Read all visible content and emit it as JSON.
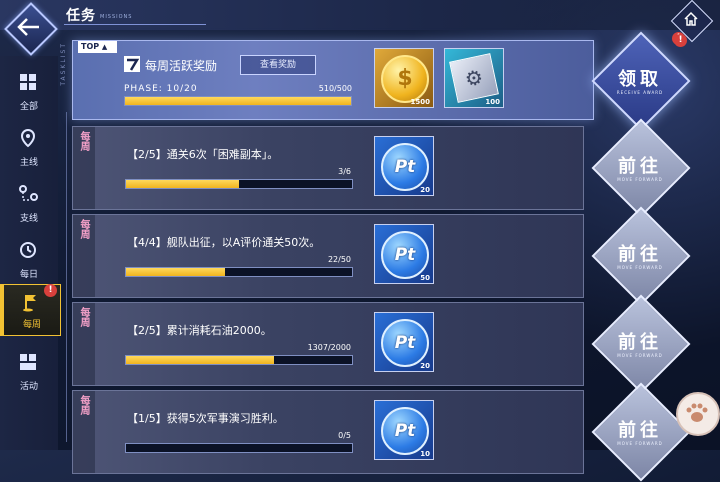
{
  "header": {
    "title": "任务",
    "subtitle": "MISSIONS"
  },
  "sidebar": {
    "tasklist_label": "TASKLIST",
    "items": [
      {
        "label": "全部",
        "icon": "grid-icon"
      },
      {
        "label": "主线",
        "icon": "map-pin-icon"
      },
      {
        "label": "支线",
        "icon": "branch-pins-icon"
      },
      {
        "label": "每日",
        "icon": "clock-icon"
      },
      {
        "label": "每周",
        "icon": "flag-icon",
        "active": true,
        "alert": "!"
      },
      {
        "label": "活动",
        "icon": "blocks-icon"
      }
    ]
  },
  "top_card": {
    "tag": "TOP",
    "title": "每周活跃奖励",
    "view_button": "查看奖励",
    "phase_label": "PHASE: 10/20",
    "progress_text": "510/500",
    "progress_fraction": 1.0,
    "rewards": [
      {
        "icon": "gold-coin-icon",
        "amount": "1500"
      },
      {
        "icon": "equipment-box-icon",
        "amount": "100"
      }
    ],
    "claim_button": {
      "label": "领取",
      "sub": "RECEIVE AWARD",
      "alert": "!"
    }
  },
  "tasks": [
    {
      "kind": "每周",
      "desc": "【2/5】通关6次「困难副本」。",
      "progress": "3/6",
      "fraction": 0.5,
      "reward_amount": "20",
      "button": "前往",
      "button_sub": "MOVE FORWARD"
    },
    {
      "kind": "每周",
      "desc": "【4/4】舰队出征，以A评价通关50次。",
      "progress": "22/50",
      "fraction": 0.44,
      "reward_amount": "50",
      "button": "前往",
      "button_sub": "MOVE FORWARD"
    },
    {
      "kind": "每周",
      "desc": "【2/5】累计消耗石油2000。",
      "progress": "1307/2000",
      "fraction": 0.6535,
      "reward_amount": "20",
      "button": "前往",
      "button_sub": "MOVE FORWARD"
    },
    {
      "kind": "每周",
      "desc": "【1/5】获得5次军事演习胜利。",
      "progress": "0/5",
      "fraction": 0.0,
      "reward_amount": "10",
      "button": "前往",
      "button_sub": "MOVE FORWARD"
    }
  ],
  "reward_coin_text": "Pt",
  "home_alert": "!",
  "colors": {
    "accent_yellow": "#f2c233",
    "claim_blue": "#3a4e9f",
    "alert_red": "#d8403c"
  }
}
